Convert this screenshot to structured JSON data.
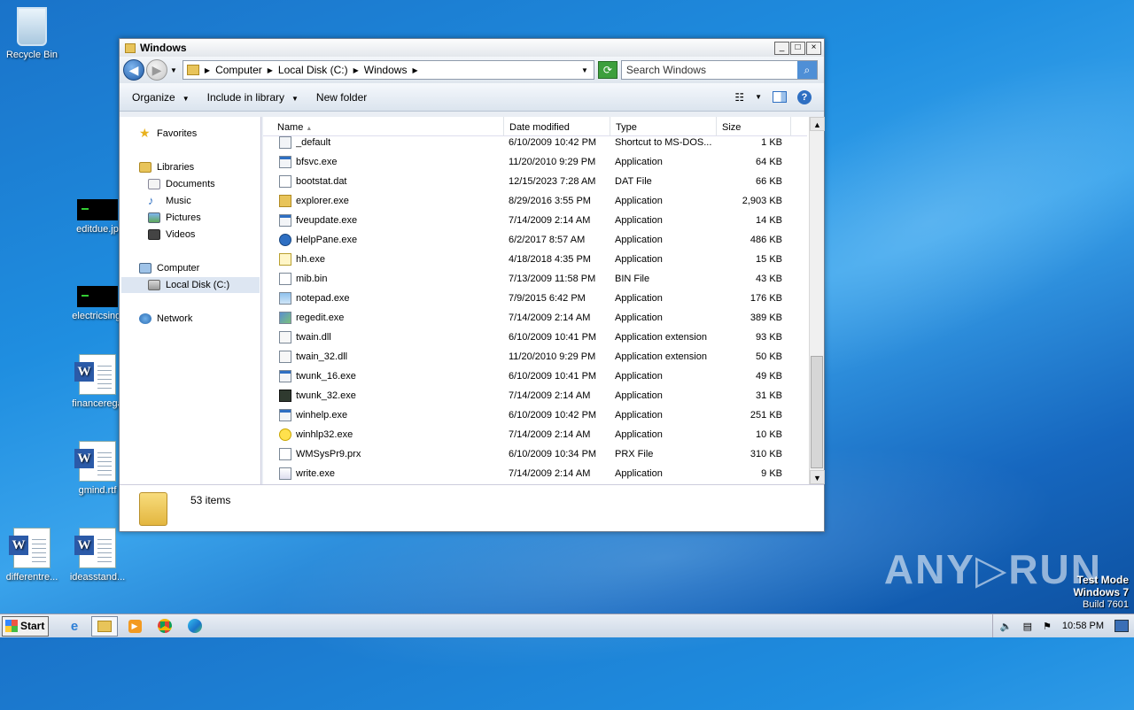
{
  "desktop": {
    "icons": [
      {
        "label": "Recycle Bin"
      },
      {
        "label": "editdue.jp"
      },
      {
        "label": "electricsingl"
      },
      {
        "label": "financerega"
      },
      {
        "label": "gmind.rtf"
      },
      {
        "label": "differentre..."
      },
      {
        "label": "ideasstand..."
      }
    ]
  },
  "window": {
    "title": "Windows",
    "controls": {
      "minimize": "_",
      "maximize": "□",
      "close": "×"
    },
    "address": {
      "crumbs": [
        "Computer",
        "Local Disk (C:)",
        "Windows"
      ]
    },
    "search": {
      "placeholder": "Search Windows"
    },
    "toolbar": {
      "organize": "Organize",
      "include": "Include in library",
      "newfolder": "New folder"
    }
  },
  "nav": {
    "favorites": "Favorites",
    "libraries": "Libraries",
    "documents": "Documents",
    "music": "Music",
    "pictures": "Pictures",
    "videos": "Videos",
    "computer": "Computer",
    "localdisk": "Local Disk (C:)",
    "network": "Network"
  },
  "columns": {
    "name": "Name",
    "date": "Date modified",
    "type": "Type",
    "size": "Size"
  },
  "files": [
    {
      "name": "_default",
      "date": "6/10/2009 10:42 PM",
      "type": "Shortcut to MS-DOS...",
      "size": "1 KB",
      "icon": "shortcut-icon"
    },
    {
      "name": "bfsvc.exe",
      "date": "11/20/2010 9:29 PM",
      "type": "Application",
      "size": "64 KB",
      "icon": "application-icon"
    },
    {
      "name": "bootstat.dat",
      "date": "12/15/2023 7:28 AM",
      "type": "DAT File",
      "size": "66 KB",
      "icon": "file-icon"
    },
    {
      "name": "explorer.exe",
      "date": "8/29/2016 3:55 PM",
      "type": "Application",
      "size": "2,903 KB",
      "icon": "folder-app-icon"
    },
    {
      "name": "fveupdate.exe",
      "date": "7/14/2009 2:14 AM",
      "type": "Application",
      "size": "14 KB",
      "icon": "application-icon"
    },
    {
      "name": "HelpPane.exe",
      "date": "6/2/2017 8:57 AM",
      "type": "Application",
      "size": "486 KB",
      "icon": "help-icon"
    },
    {
      "name": "hh.exe",
      "date": "4/18/2018 4:35 PM",
      "type": "Application",
      "size": "15 KB",
      "icon": "help-doc-icon"
    },
    {
      "name": "mib.bin",
      "date": "7/13/2009 11:58 PM",
      "type": "BIN File",
      "size": "43 KB",
      "icon": "file-icon"
    },
    {
      "name": "notepad.exe",
      "date": "7/9/2015 6:42 PM",
      "type": "Application",
      "size": "176 KB",
      "icon": "notepad-icon"
    },
    {
      "name": "regedit.exe",
      "date": "7/14/2009 2:14 AM",
      "type": "Application",
      "size": "389 KB",
      "icon": "regedit-icon"
    },
    {
      "name": "twain.dll",
      "date": "6/10/2009 10:41 PM",
      "type": "Application extension",
      "size": "93 KB",
      "icon": "dll-icon"
    },
    {
      "name": "twain_32.dll",
      "date": "11/20/2010 9:29 PM",
      "type": "Application extension",
      "size": "50 KB",
      "icon": "dll-icon"
    },
    {
      "name": "twunk_16.exe",
      "date": "6/10/2009 10:41 PM",
      "type": "Application",
      "size": "49 KB",
      "icon": "application-icon"
    },
    {
      "name": "twunk_32.exe",
      "date": "7/14/2009 2:14 AM",
      "type": "Application",
      "size": "31 KB",
      "icon": "twunk-icon"
    },
    {
      "name": "winhelp.exe",
      "date": "6/10/2009 10:42 PM",
      "type": "Application",
      "size": "251 KB",
      "icon": "application-icon"
    },
    {
      "name": "winhlp32.exe",
      "date": "7/14/2009 2:14 AM",
      "type": "Application",
      "size": "10 KB",
      "icon": "question-icon"
    },
    {
      "name": "WMSysPr9.prx",
      "date": "6/10/2009 10:34 PM",
      "type": "PRX File",
      "size": "310 KB",
      "icon": "file-icon"
    },
    {
      "name": "write.exe",
      "date": "7/14/2009 2:14 AM",
      "type": "Application",
      "size": "9 KB",
      "icon": "write-icon"
    }
  ],
  "status": {
    "count": "53 items"
  },
  "taskbar": {
    "start": "Start",
    "clock": "10:58 PM"
  },
  "watermark": {
    "brand": "ANY▷RUN",
    "testmode": "Test Mode",
    "os": "Windows 7",
    "build": "Build 7601"
  },
  "colors": {
    "desktop": "#1f8ee0",
    "selection": "#dde6f2",
    "accent": "#1e5aa6"
  }
}
